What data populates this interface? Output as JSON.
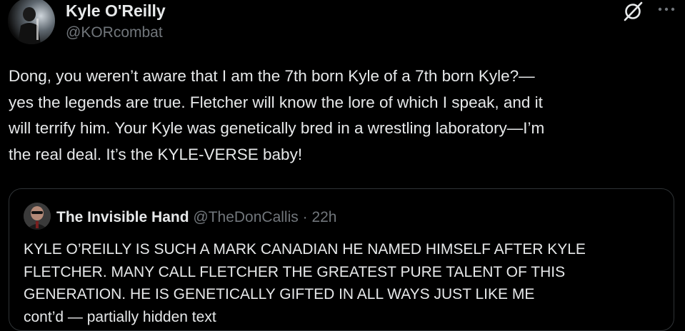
{
  "author": {
    "display_name": "Kyle O'Reilly",
    "handle": "@KORcombat",
    "avatar": "avatar-photo"
  },
  "actions": {
    "grok_icon": "grok-icon",
    "more_icon": "more-icon"
  },
  "tweet": {
    "lines": [
      "Dong, you weren’t aware that I am the 7th born Kyle of a 7th born Kyle?—",
      "yes the legends are true. Fletcher will know the lore of which I speak, and it",
      "will terrify him. Your Kyle was genetically bred in a wrestling laboratory—I’m",
      "the real deal. It’s the KYLE-VERSE baby!"
    ]
  },
  "quote": {
    "display_name": "The Invisible Hand",
    "handle": "@TheDonCallis",
    "separator": " · ",
    "time": "22h",
    "lines": [
      "KYLE O’REILLY IS SUCH A MARK CANADIAN HE NAMED HIMSELF AFTER KYLE",
      "FLETCHER.  MANY CALL FLETCHER THE GREATEST PURE TALENT OF THIS",
      "GENERATION. HE IS GENETICALLY  GIFTED IN ALL WAYS JUST LIKE ME",
      "cont’d — partially hidden text"
    ]
  },
  "colors": {
    "background": "#000000",
    "primary_text": "#e7e9ea",
    "secondary_text": "#71767b",
    "border": "#2f3336"
  }
}
